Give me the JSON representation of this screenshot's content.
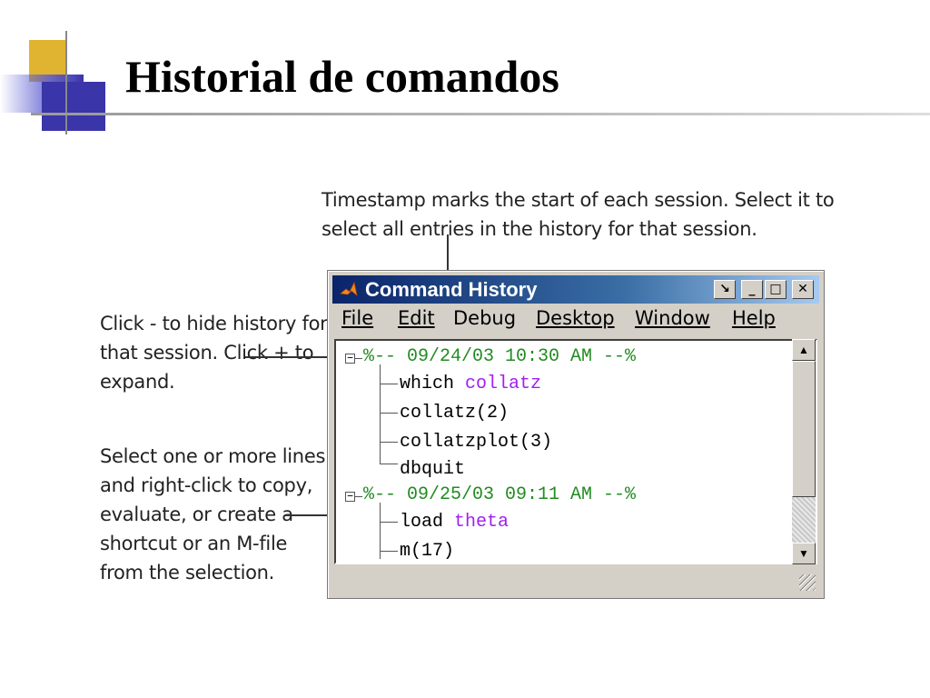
{
  "slide": {
    "title": "Historial de comandos"
  },
  "callouts": {
    "timestamp": "Timestamp marks the start of each session. Select it to select all entries in the history for that session.",
    "collapse": "Click - to hide history for that session. Click + to expand.",
    "select": "Select one or more lines and right-click to copy, evaluate, or create a shortcut or an M-file from the selection."
  },
  "window": {
    "title": "Command History",
    "icon": "matlab-logo-icon",
    "controls": [
      "restore-icon",
      "minimize-icon",
      "maximize-icon",
      "close-icon"
    ]
  },
  "menu": {
    "file": "File",
    "edit": "Edit",
    "debug": "Debug",
    "desktop": "Desktop",
    "window": "Window",
    "help": "Help"
  },
  "history": {
    "session1": {
      "timestamp": "%-- 09/24/03 10:30 AM --%",
      "entries": [
        {
          "cmd": "which",
          "arg": "collatz"
        },
        {
          "cmd": "collatz(2)",
          "arg": ""
        },
        {
          "cmd": "collatzplot(3)",
          "arg": ""
        },
        {
          "cmd": "dbquit",
          "arg": ""
        }
      ]
    },
    "session2": {
      "timestamp": "%-- 09/25/03 09:11 AM --%",
      "entries": [
        {
          "cmd": "load",
          "arg": "theta"
        },
        {
          "cmd": "m(17)",
          "arg": ""
        }
      ]
    }
  },
  "colors": {
    "timestamp": "#228b22",
    "keyword_arg": "#a020f0",
    "titlebar_start": "#0a246a",
    "titlebar_end": "#a6caf0"
  }
}
